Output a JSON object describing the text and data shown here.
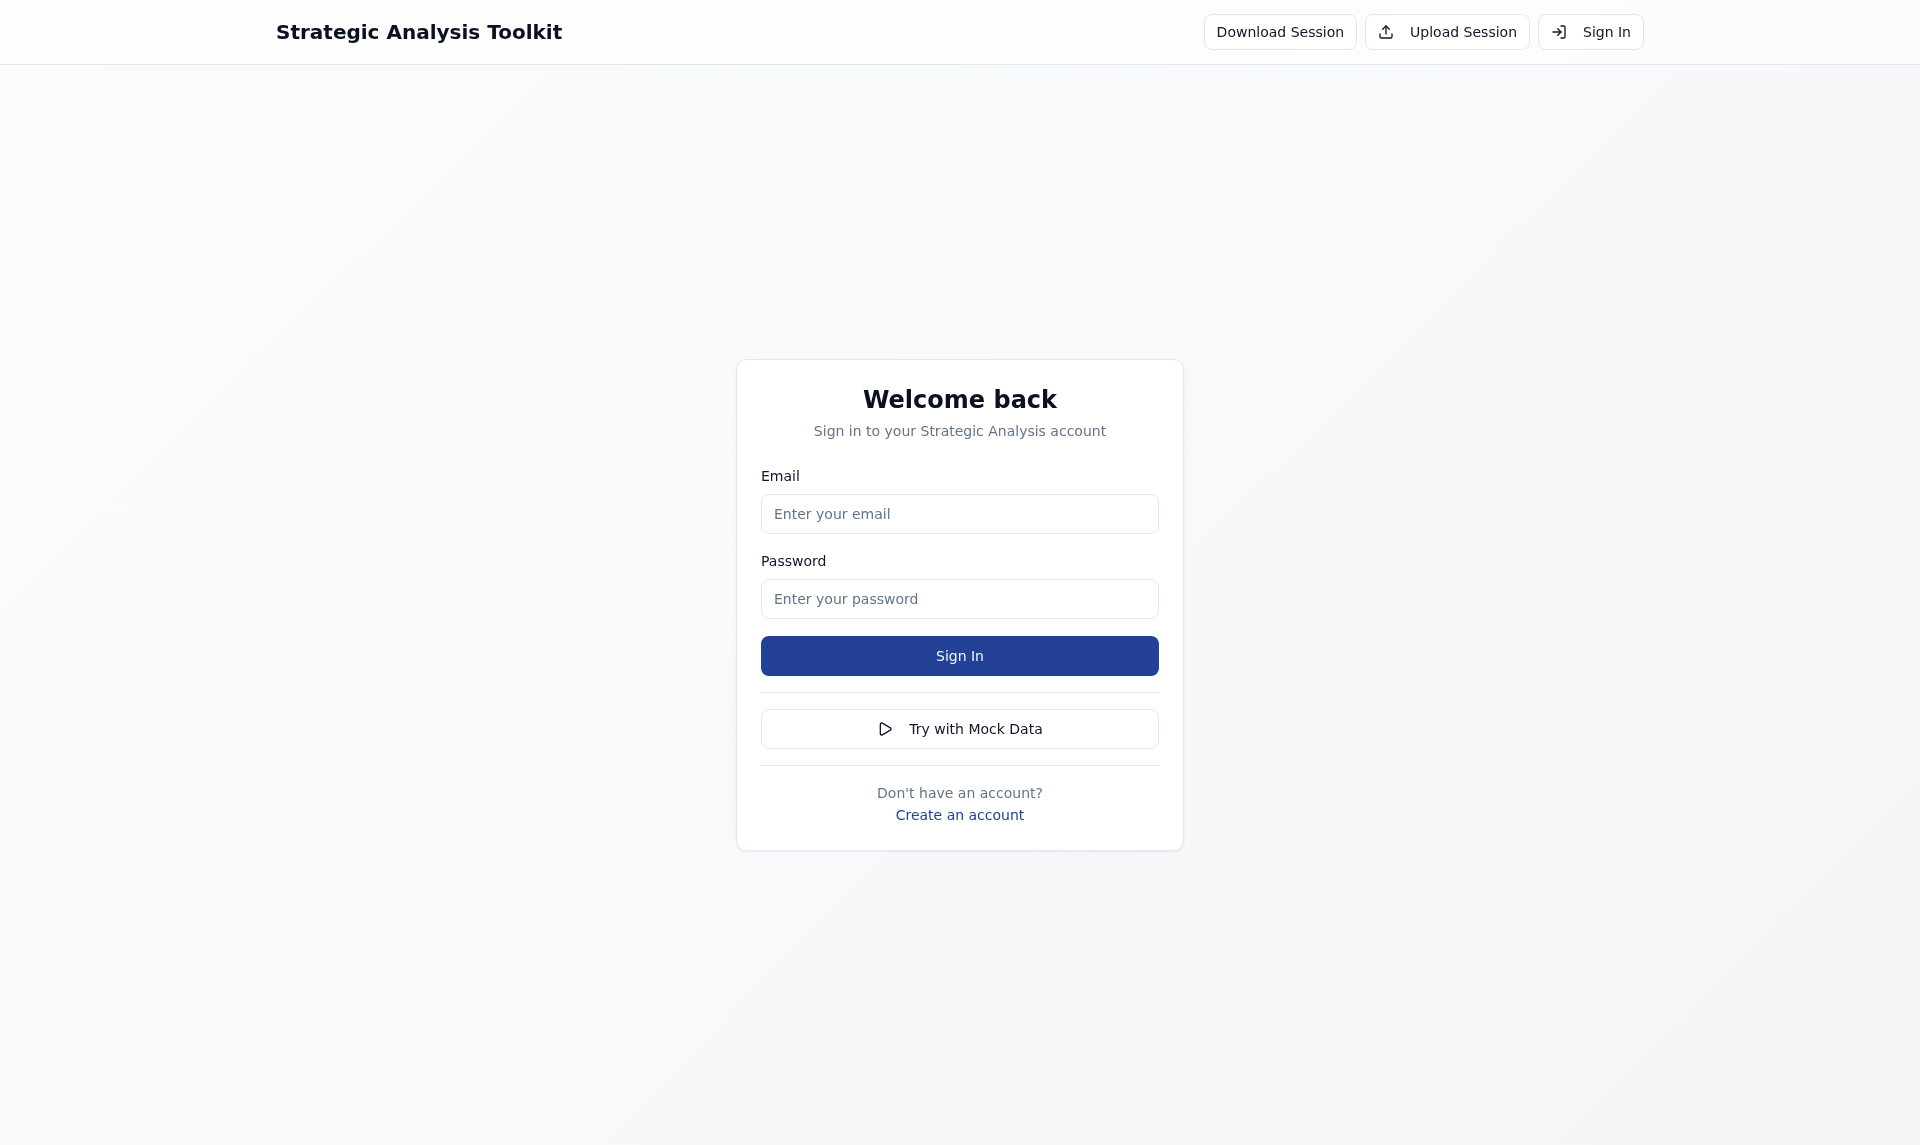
{
  "header": {
    "title": "Strategic Analysis Toolkit",
    "buttons": [
      {
        "label": "Download Session",
        "kind": "plain"
      },
      {
        "label": "Upload Session",
        "kind": "upload"
      },
      {
        "label": "Sign In",
        "kind": "signin"
      }
    ]
  },
  "login_card": {
    "title": "Welcome back",
    "subtitle": "Sign in to your Strategic Analysis account",
    "fields": [
      {
        "label": "Email",
        "placeholder": "Enter your email"
      },
      {
        "label": "Password",
        "placeholder": "Enter your password"
      }
    ],
    "submit_button": "Sign In",
    "mock_button": "Try with Mock Data",
    "footer": {
      "prompt": "Don't have an account?",
      "link": "Create an account"
    }
  }
}
